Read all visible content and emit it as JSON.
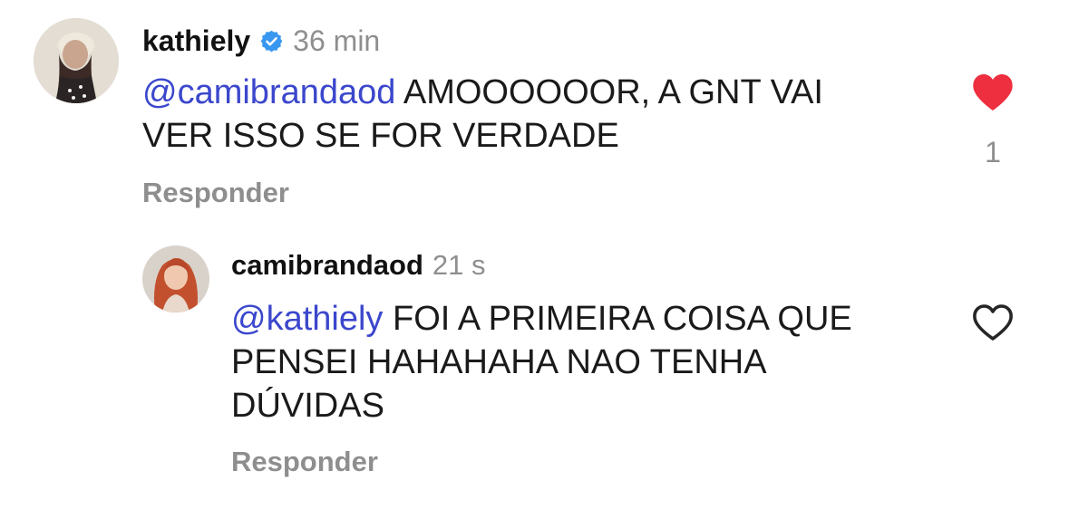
{
  "comments": [
    {
      "username": "kathiely",
      "verified": true,
      "time": "36 min",
      "mention": "@camibrandaod",
      "text_line1": " AMOOOOOOR, A GNT VAI",
      "text_line2": "VER ISSO SE FOR VERDADE",
      "reply_label": "Responder",
      "liked": true,
      "like_count": "1"
    },
    {
      "username": "camibrandaod",
      "verified": false,
      "time": "21 s",
      "mention": "@kathiely",
      "text_line1": " FOI A PRIMEIRA COISA QUE",
      "text_line2": "PENSEI HAHAHAHA NAO TENHA",
      "text_line3": "DÚVIDAS",
      "reply_label": "Responder",
      "liked": false
    }
  ],
  "icons": {
    "verified": "verified-badge-icon",
    "heart_filled": "heart-filled-icon",
    "heart_outline": "heart-outline-icon"
  },
  "colors": {
    "mention": "#3b47cc",
    "muted": "#8e8e8e",
    "like_red": "#ed2f3f",
    "verified_blue": "#3897f0"
  }
}
